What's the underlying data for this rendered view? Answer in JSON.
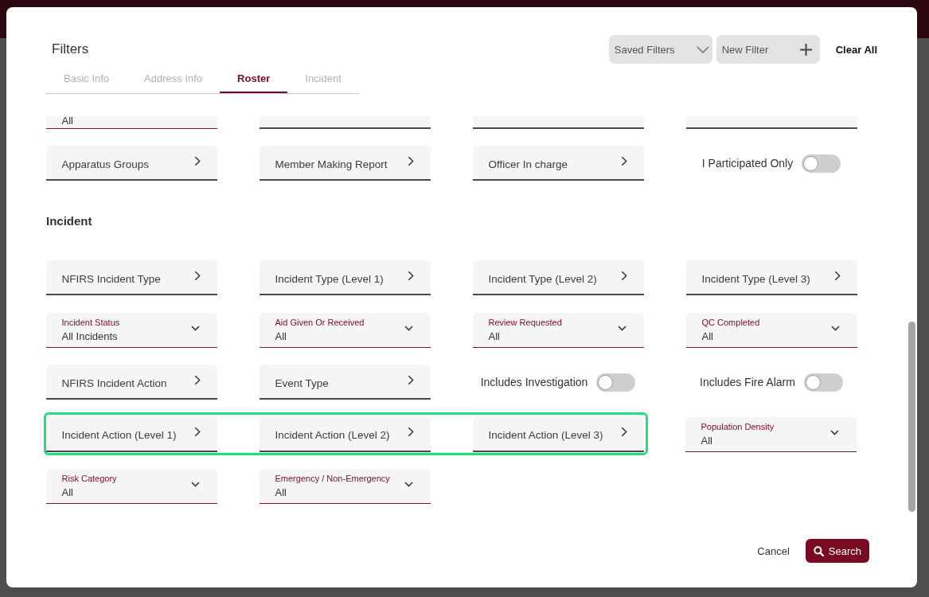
{
  "dialog": {
    "title": "Filters",
    "header_buttons": [
      {
        "kind": "dropdown",
        "label": "Saved Filters"
      },
      {
        "kind": "add",
        "label": "New Filter"
      },
      {
        "kind": "strong_link",
        "label": "Clear All"
      }
    ],
    "tabs": [
      {
        "label": "Basic Info",
        "selected": false
      },
      {
        "label": "Address Info",
        "selected": false
      },
      {
        "label": "Roster",
        "selected": true
      },
      {
        "label": "Incident",
        "selected": false
      }
    ],
    "sections": [
      {
        "rows": [
          {
            "clipped": true,
            "groups": [
              {
                "highlighted": false,
                "fields": [
                  {
                    "kind": "select",
                    "value": "All"
                  },
                  {
                    "kind": "picker"
                  },
                  {
                    "kind": "picker"
                  },
                  {
                    "kind": "picker"
                  }
                ]
              }
            ]
          },
          {
            "clipped": false,
            "groups": [
              {
                "highlighted": false,
                "fields": [
                  {
                    "kind": "picker",
                    "label": "Apparatus Groups"
                  },
                  {
                    "kind": "picker",
                    "label": "Member Making Report"
                  },
                  {
                    "kind": "picker",
                    "label": "Officer In charge"
                  },
                  {
                    "kind": "toggle",
                    "label": "I Participated Only",
                    "on": false
                  }
                ]
              }
            ]
          }
        ]
      },
      {
        "title": "Incident",
        "rows": [
          {
            "clipped": false,
            "groups": [
              {
                "highlighted": false,
                "fields": [
                  {
                    "kind": "picker",
                    "label": "NFIRS Incident Type"
                  },
                  {
                    "kind": "picker",
                    "label": "Incident Type (Level 1)"
                  },
                  {
                    "kind": "picker",
                    "label": "Incident Type (Level 2)"
                  },
                  {
                    "kind": "picker",
                    "label": "Incident Type (Level 3)"
                  }
                ]
              }
            ]
          },
          {
            "clipped": false,
            "groups": [
              {
                "highlighted": false,
                "fields": [
                  {
                    "kind": "select",
                    "label": "Incident Status",
                    "value": "All Incidents"
                  },
                  {
                    "kind": "select",
                    "label": "Aid Given Or Received",
                    "value": "All"
                  },
                  {
                    "kind": "select",
                    "label": "Review Requested",
                    "value": "All"
                  },
                  {
                    "kind": "select",
                    "label": "QC Completed",
                    "value": "All"
                  }
                ]
              }
            ]
          },
          {
            "clipped": false,
            "groups": [
              {
                "highlighted": false,
                "fields": [
                  {
                    "kind": "picker",
                    "label": "NFIRS Incident Action"
                  },
                  {
                    "kind": "picker",
                    "label": "Event Type"
                  },
                  {
                    "kind": "toggle",
                    "label": "Includes Investigation",
                    "on": false
                  },
                  {
                    "kind": "toggle",
                    "label": "Includes Fire Alarm",
                    "on": false
                  }
                ]
              }
            ]
          },
          {
            "clipped": false,
            "groups": [
              {
                "highlighted": true,
                "fields": [
                  {
                    "kind": "picker",
                    "label": "Incident Action (Level 1)"
                  },
                  {
                    "kind": "picker",
                    "label": "Incident Action (Level 2)"
                  },
                  {
                    "kind": "picker",
                    "label": "Incident Action (Level 3)"
                  }
                ]
              },
              {
                "highlighted": false,
                "fields": [
                  {
                    "kind": "select",
                    "label": "Population Density",
                    "value": "All"
                  }
                ]
              }
            ]
          },
          {
            "clipped": false,
            "groups": [
              {
                "highlighted": false,
                "fields": [
                  {
                    "kind": "select",
                    "label": "Risk Category",
                    "value": "All"
                  },
                  {
                    "kind": "select",
                    "label": "Emergency / Non-Emergency",
                    "value": "All"
                  }
                ]
              }
            ]
          }
        ]
      }
    ],
    "footer_buttons": [
      {
        "kind": "link",
        "label": "Cancel"
      },
      {
        "kind": "primary",
        "label": "Search"
      }
    ]
  }
}
